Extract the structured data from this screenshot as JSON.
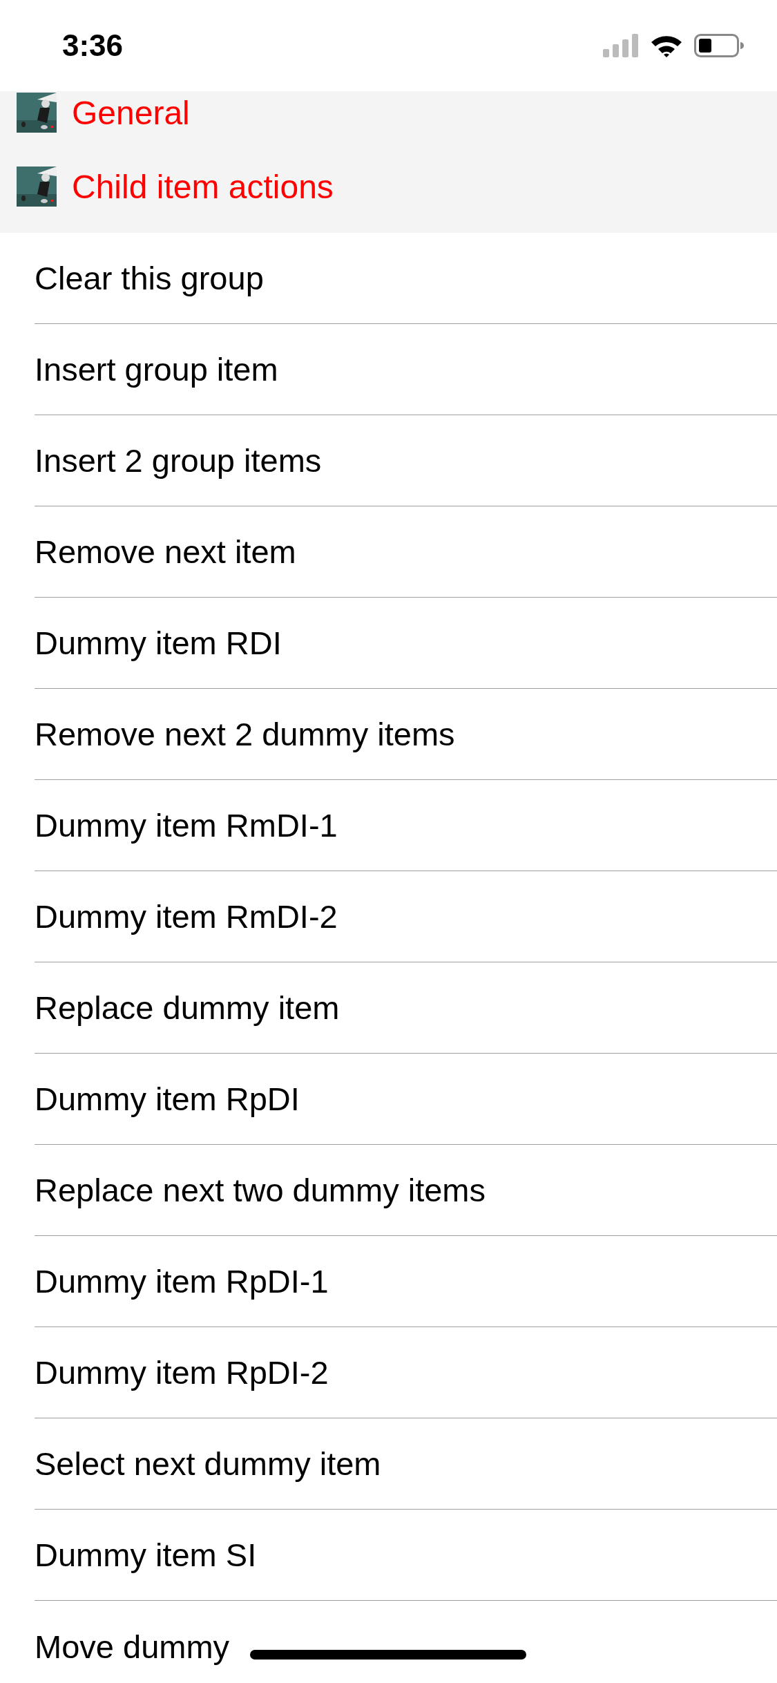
{
  "status_bar": {
    "time": "3:36"
  },
  "sections": [
    {
      "title": "General",
      "kind": "picture"
    },
    {
      "title": "Child item actions",
      "kind": "picture"
    }
  ],
  "items": [
    "Clear this group",
    "Insert group item",
    "Insert 2 group items",
    "Remove next item",
    "Dummy item RDI",
    "Remove next 2 dummy items",
    "Dummy item RmDI-1",
    "Dummy item RmDI-2",
    "Replace dummy item",
    "Dummy item RpDI",
    "Replace next two dummy items",
    "Dummy item RpDI-1",
    "Dummy item RpDI-2",
    "Select next dummy item",
    "Dummy item SI",
    "Move dummy"
  ]
}
